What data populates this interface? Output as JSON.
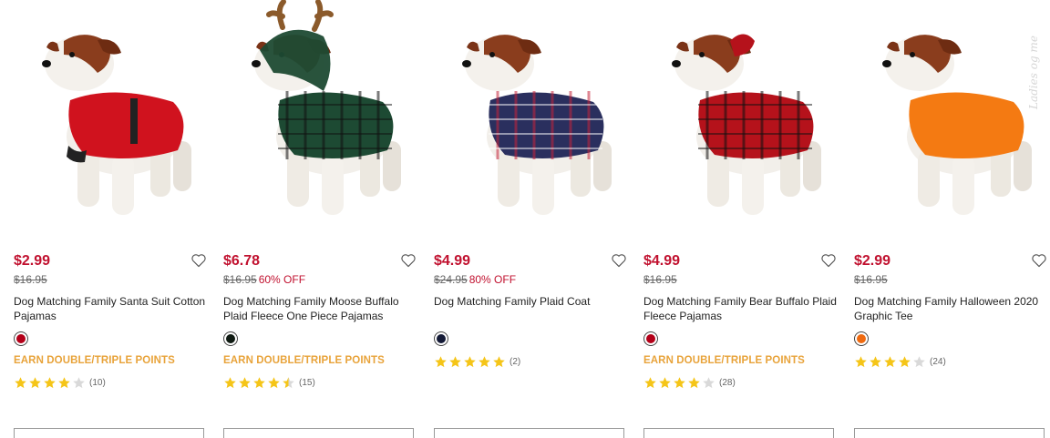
{
  "products": [
    {
      "price": "$2.99",
      "original_price": "$16.95",
      "discount": "",
      "name": "Dog Matching Family Santa Suit Cotton Pajamas",
      "swatch_color": "#b30019",
      "promo": "EARN DOUBLE/TRIPLE POINTS",
      "rating": 4,
      "review_count": "(10)",
      "image_icon": "dog-santa-pajamas-image",
      "garment_color": "#d0121e"
    },
    {
      "price": "$6.78",
      "original_price": "$16.95",
      "discount": "60% OFF",
      "name": "Dog Matching Family Moose Buffalo Plaid Fleece One Piece Pajamas",
      "swatch_color": "#0f1a12",
      "promo": "EARN DOUBLE/TRIPLE POINTS",
      "rating": 4.5,
      "review_count": "(15)",
      "image_icon": "dog-moose-fleece-image",
      "garment_color": "#1d4a33"
    },
    {
      "price": "$4.99",
      "original_price": "$24.95",
      "discount": "80% OFF",
      "name": "Dog Matching Family Plaid Coat",
      "swatch_color": "#141a36",
      "promo": "",
      "rating": 5,
      "review_count": "(2)",
      "image_icon": "dog-plaid-coat-image",
      "garment_color": "#2a2f5e"
    },
    {
      "price": "$4.99",
      "original_price": "$16.95",
      "discount": "",
      "name": "Dog Matching Family Bear Buffalo Plaid Fleece Pajamas",
      "swatch_color": "#b30019",
      "promo": "EARN DOUBLE/TRIPLE POINTS",
      "rating": 4,
      "review_count": "(28)",
      "image_icon": "dog-bear-plaid-image",
      "garment_color": "#b5121b"
    },
    {
      "price": "$2.99",
      "original_price": "$16.95",
      "discount": "",
      "name": "Dog Matching Family Halloween 2020 Graphic Tee",
      "swatch_color": "#ef6a10",
      "promo": "",
      "rating": 4,
      "review_count": "(24)",
      "image_icon": "dog-halloween-tee-image",
      "garment_color": "#f47a12"
    }
  ],
  "colors": {
    "price": "#c1112f",
    "promo": "#e8a33a",
    "star_filled": "#f5c518",
    "star_empty": "#d9d9d9"
  }
}
